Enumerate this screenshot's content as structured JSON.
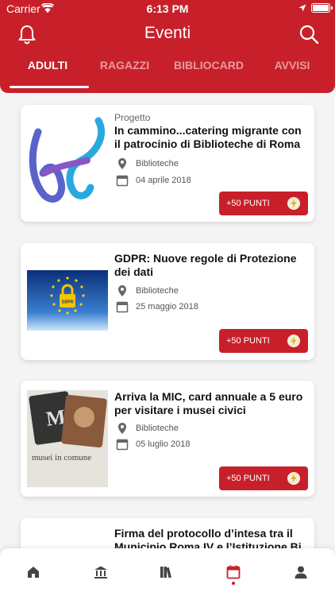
{
  "status_bar": {
    "carrier": "Carrier",
    "time": "6:13 PM"
  },
  "header": {
    "title": "Eventi"
  },
  "tabs": [
    {
      "label": "ADULTI",
      "active": true
    },
    {
      "label": "RAGAZZI",
      "active": false
    },
    {
      "label": "BIBLIOCARD",
      "active": false
    },
    {
      "label": "AVVISI",
      "active": false
    }
  ],
  "events": [
    {
      "category": "Progetto",
      "title": "In cammino...catering migrante con il patrocinio di Biblioteche di Roma",
      "place": "Biblioteche",
      "date": "04 aprile 2018",
      "points": "+50 PUNTI",
      "thumb_icon": "ribbon-h-logo-icon"
    },
    {
      "category": "",
      "title": "GDPR: Nuove regole di Protezione dei dati",
      "place": "Biblioteche",
      "date": "25 maggio 2018",
      "points": "+50 PUNTI",
      "thumb_icon": "eu-gdpr-padlock-icon",
      "thumb_text": "GDPR"
    },
    {
      "category": "",
      "title": "Arriva la MIC, card annuale a 5 euro per visitare i musei civici",
      "place": "Biblioteche",
      "date": "05 luglio 2018",
      "points": "+50 PUNTI",
      "thumb_icon": "mic-card-icon",
      "thumb_text": "musei in comune"
    },
    {
      "category": "",
      "title": "Firma del protocollo d’intesa tra il Municipio Roma IV e l’Istituzione Bi",
      "place": "",
      "date": "",
      "points": ""
    }
  ],
  "tabbar": {
    "items": [
      {
        "icon": "home-icon",
        "active": false
      },
      {
        "icon": "library-building-icon",
        "active": false
      },
      {
        "icon": "books-icon",
        "active": false
      },
      {
        "icon": "calendar-icon",
        "active": true
      },
      {
        "icon": "profile-icon",
        "active": false
      }
    ]
  },
  "colors": {
    "primary": "#c8202a",
    "background": "#f4f4f4"
  }
}
